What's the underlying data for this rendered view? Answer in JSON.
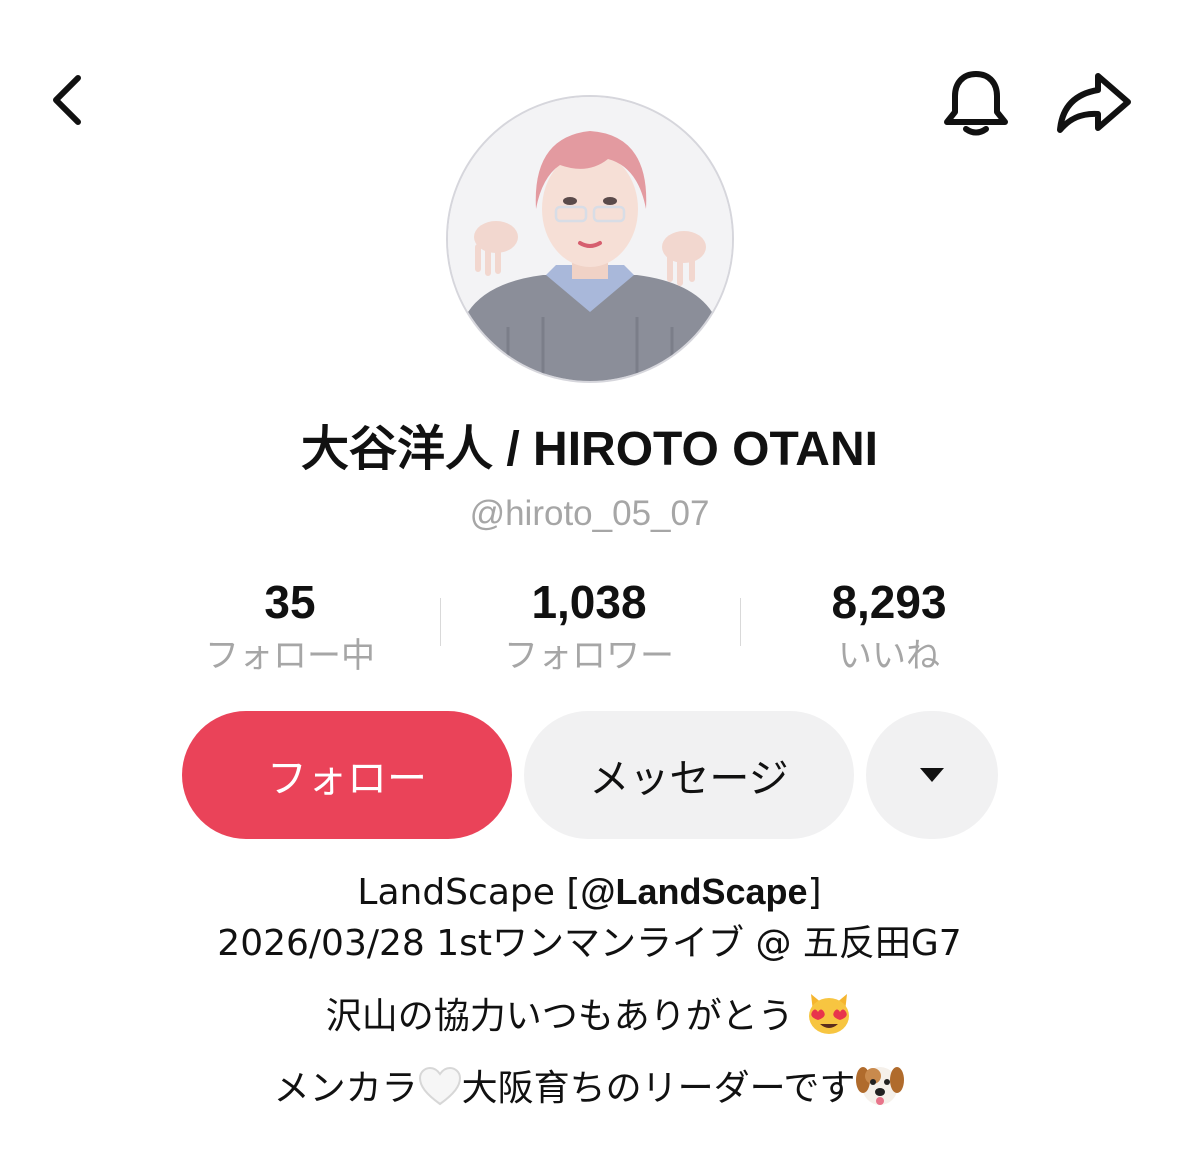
{
  "profile": {
    "display_name": "大谷洋人 / HIROTO OTANI",
    "handle": "@hiroto_05_07"
  },
  "stats": {
    "following": {
      "value": "35",
      "label": "フォロー中"
    },
    "followers": {
      "value": "1,038",
      "label": "フォロワー"
    },
    "likes": {
      "value": "8,293",
      "label": "いいね"
    }
  },
  "actions": {
    "follow_label": "フォロー",
    "message_label": "メッセージ",
    "more_icon": "caret-down-icon"
  },
  "icons": {
    "back": "chevron-left-icon",
    "notifications": "bell-icon",
    "share": "share-arrow-icon"
  },
  "bio": {
    "line1_prefix": "LandScape [",
    "line1_mention": "@LandScape",
    "line1_suffix": "]",
    "line2": "2026/03/28 1stワンマンライブ @ 五反田G7",
    "line3": "沢山の協力いつもありがとう",
    "line3_emoji": "heart-eyes-cat-emoji",
    "line4_part1": "メンカラ",
    "line4_emoji1": "white-heart-emoji",
    "line4_part2": "大阪育ちのリーダーです",
    "line4_emoji2": "dog-face-emoji"
  },
  "colors": {
    "follow_button": "#ea4359",
    "secondary_button": "#f1f1f2",
    "muted_text": "#a6a6a6"
  }
}
